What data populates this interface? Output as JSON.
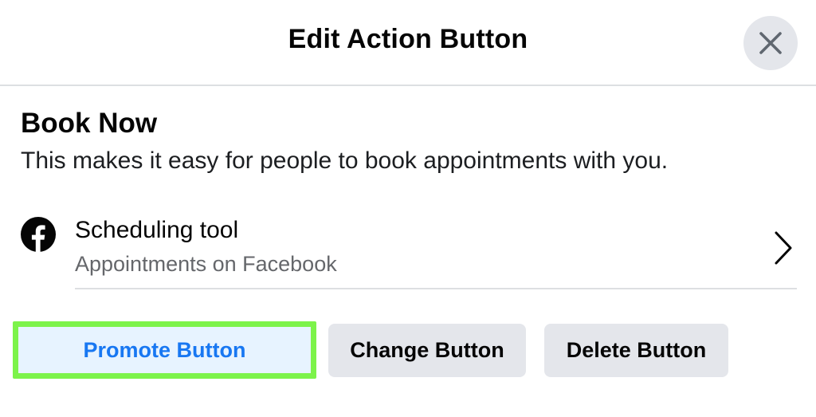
{
  "header": {
    "title": "Edit Action Button",
    "close_icon": "close-icon"
  },
  "section": {
    "title": "Book Now",
    "description": "This makes it easy for people to book appointments with you."
  },
  "tool": {
    "icon": "facebook-icon",
    "name": "Scheduling tool",
    "subtitle": "Appointments on Facebook",
    "chevron_icon": "chevron-right-icon"
  },
  "buttons": {
    "promote": "Promote Button",
    "change": "Change Button",
    "delete": "Delete Button"
  },
  "colors": {
    "brand_blue": "#1877f2",
    "highlight_green": "#7cf34a",
    "button_gray": "#e4e6eb",
    "promote_bg": "#e7f3ff",
    "secondary_text": "#65676b"
  }
}
